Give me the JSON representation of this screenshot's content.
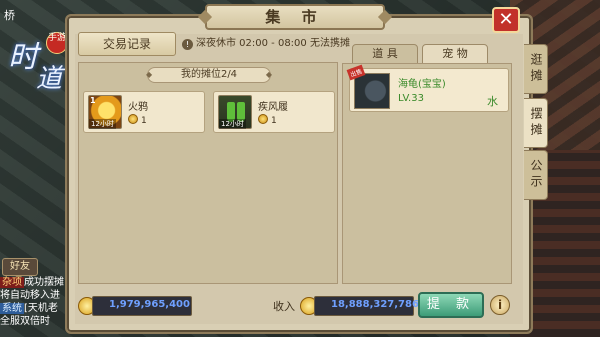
{
  "game": {
    "logo_text_1": "时",
    "logo_text_2": "道",
    "logo_badge": "手游",
    "side_label": "桥",
    "friend_label": "好友",
    "chat": [
      {
        "tag": "杂项",
        "text": "成功摆摊"
      },
      {
        "tag": "",
        "text": "将自动移入进"
      },
      {
        "tag2": "系统",
        "text": "[天机老"
      },
      {
        "tag": "",
        "text": "全服双倍时"
      }
    ]
  },
  "market": {
    "title": "集 市",
    "close_label": "✕",
    "trade_record_button": "交易记录",
    "notice": "深夜休市 02:00 - 08:00 无法携摊",
    "stall_header": "我的摊位2/4",
    "stall_items": [
      {
        "name": "火鸦",
        "price": "1",
        "count_label": "1",
        "tag": "12小时",
        "icon": "fire-crow-icon"
      },
      {
        "name": "疾风履",
        "price": "1",
        "count_label": "",
        "tag": "12小时",
        "icon": "wind-boots-icon"
      }
    ],
    "tabs": [
      "道 具",
      "宠 物"
    ],
    "active_tab": "宠 物",
    "pets": [
      {
        "name": "海龟(宝宝)",
        "level": "LV.33",
        "element": "水",
        "ribbon": "出售",
        "icon": "sea-turtle-icon"
      }
    ],
    "side_tabs": [
      "逛摊",
      "摆摊",
      "公示"
    ],
    "active_side_tab": "摆摊",
    "gold_balance": "1,979,965,400",
    "income_label": "收入",
    "income_value": "18,888,327,786",
    "withdraw_button": "提 款",
    "help_label": "i"
  },
  "colors": {
    "panel_bg": "#d9cfb4",
    "withdraw_green": "#3d9c78",
    "close_red": "#c2312a",
    "pet_text_green": "#3a8a2a",
    "gold_value_blue": "#6fa0ff"
  }
}
